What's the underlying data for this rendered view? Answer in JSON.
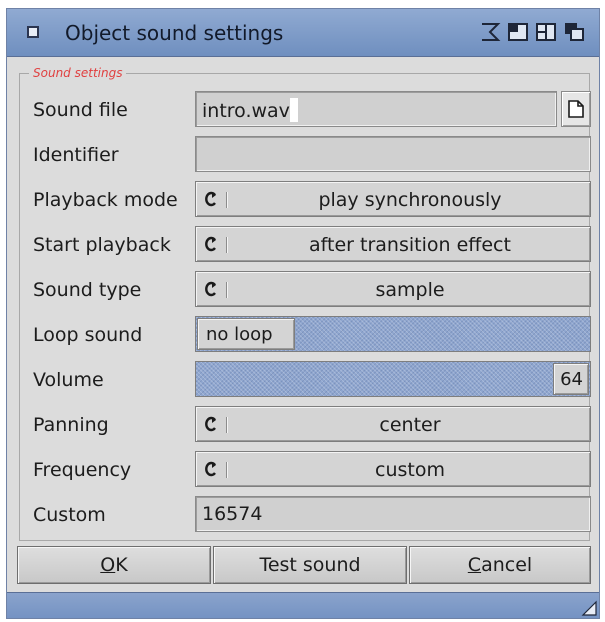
{
  "window": {
    "title": "Object sound settings",
    "group_label": "Sound settings"
  },
  "colors": {
    "titlebar": "#7f9cc9",
    "legend": "#e04040",
    "hatch": "#8fa6cf",
    "panel": "#dcdcdc"
  },
  "fields": {
    "sound_file": {
      "label": "Sound file",
      "value": "intro.wav"
    },
    "identifier": {
      "label": "Identifier",
      "value": ""
    },
    "playback_mode": {
      "label": "Playback mode",
      "value": "play synchronously"
    },
    "start_playback": {
      "label": "Start playback",
      "value": "after transition effect"
    },
    "sound_type": {
      "label": "Sound type",
      "value": "sample"
    },
    "loop_sound": {
      "label": "Loop sound",
      "value": "no loop"
    },
    "volume": {
      "label": "Volume",
      "value": "64"
    },
    "panning": {
      "label": "Panning",
      "value": "center"
    },
    "frequency": {
      "label": "Frequency",
      "value": "custom"
    },
    "custom": {
      "label": "Custom",
      "value": "16574"
    }
  },
  "buttons": {
    "ok": {
      "underline": "O",
      "rest": "K"
    },
    "test_sound": "Test sound",
    "cancel": {
      "underline": "C",
      "rest": "ancel"
    }
  },
  "icons": {
    "close": "close-gadget-icon",
    "iconify": "iconify-icon",
    "zoom": "zoom-icon",
    "popup": "popup-icon",
    "depth": "depth-icon",
    "file": "file-request-icon",
    "cycle": "cycle-icon",
    "resize": "resize-grip-icon"
  }
}
